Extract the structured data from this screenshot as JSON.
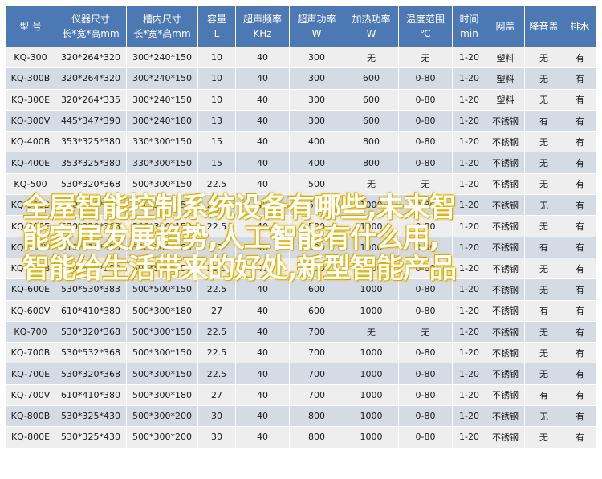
{
  "table": {
    "headers": [
      [
        "型 号",
        ""
      ],
      [
        "仪器尺寸",
        "长*宽*高mm"
      ],
      [
        "槽内尺寸",
        "长*宽*高mm"
      ],
      [
        "容量",
        "L"
      ],
      [
        "超声频率",
        "KHz"
      ],
      [
        "超声功率",
        "W"
      ],
      [
        "加热功率",
        "W"
      ],
      [
        "温度范围",
        "℃"
      ],
      [
        "时间",
        "min"
      ],
      [
        "网盖",
        ""
      ],
      [
        "降音盖",
        ""
      ],
      [
        "排水",
        ""
      ]
    ],
    "rows": [
      [
        "KQ-300",
        "320*264*320",
        "300*240*150",
        "10",
        "40",
        "300",
        "无",
        "无",
        "1-20",
        "塑料",
        "无",
        "有"
      ],
      [
        "KQ-300B",
        "320*264*320",
        "300*240*150",
        "10",
        "40",
        "300",
        "600",
        "0-80",
        "1-20",
        "塑料",
        "无",
        "有"
      ],
      [
        "KQ-300E",
        "320*264*335",
        "300*240*150",
        "10",
        "40",
        "300",
        "600",
        "0-80",
        "1-20",
        "塑料",
        "无",
        "有"
      ],
      [
        "KQ-300V",
        "445*347*390",
        "300*240*180",
        "13",
        "40",
        "300",
        "600",
        "0-80",
        "1-20",
        "不锈钢",
        "有",
        "有"
      ],
      [
        "KQ-400B",
        "353*325*380",
        "330*300*150",
        "15",
        "40",
        "400",
        "800",
        "0-80",
        "1-20",
        "不锈钢",
        "无",
        "有"
      ],
      [
        "KQ-400E",
        "353*325*380",
        "330*300*150",
        "15",
        "40",
        "400",
        "800",
        "0-80",
        "1-20",
        "不锈钢",
        "无",
        "有"
      ],
      [
        "KQ-500",
        "530*320*368",
        "500*300*150",
        "22.5",
        "40",
        "500",
        "无",
        "无",
        "1-20",
        "不锈钢",
        "无",
        "有"
      ],
      [
        "KQ-500B",
        "530*320*368",
        "500*300*150",
        "22.5",
        "40",
        "500",
        "1000",
        "0-80",
        "1-20",
        "不锈钢",
        "无",
        "有"
      ],
      [
        "KQ-500E",
        "530*320*368",
        "500*300*150",
        "22.5",
        "40",
        "500",
        "1000",
        "0-80",
        "1-20",
        "不锈钢",
        "无",
        "有"
      ],
      [
        "KQ-500V",
        "610*410*380",
        "500*300*180",
        "27",
        "40",
        "500",
        "1000",
        "0-80",
        "1-20",
        "不锈钢",
        "有",
        "有"
      ],
      [
        "KQ-600B",
        "530*530*383",
        "500*500*150",
        "22.5",
        "40",
        "600",
        "1000",
        "0-80",
        "1-20",
        "不锈钢",
        "无",
        "有"
      ],
      [
        "KQ-600E",
        "530*530*383",
        "500*500*150",
        "22.5",
        "40",
        "600",
        "1000",
        "0-80",
        "1-20",
        "不锈钢",
        "无",
        "有"
      ],
      [
        "KQ-600V",
        "610*410*380",
        "500*300*180",
        "27",
        "40",
        "600",
        "1000",
        "0-80",
        "1-20",
        "不锈钢",
        "有",
        "有"
      ],
      [
        "KQ-700",
        "530*320*368",
        "500*300*150",
        "22.5",
        "40",
        "700",
        "无",
        "无",
        "1-20",
        "不锈钢",
        "无",
        "有"
      ],
      [
        "KQ-700B",
        "530*532*368",
        "500*300*150",
        "22.5",
        "40",
        "700",
        "1000",
        "0-80",
        "1-20",
        "不锈钢",
        "无",
        "有"
      ],
      [
        "KQ-700E",
        "530*320*368",
        "500*300*150",
        "22.5",
        "40",
        "700",
        "1000",
        "0-80",
        "1-20",
        "不锈钢",
        "无",
        "有"
      ],
      [
        "KQ-700V",
        "610*410*380",
        "500*300*180",
        "27",
        "40",
        "700",
        "1000",
        "0-80",
        "1-20",
        "不锈钢",
        "有",
        "有"
      ],
      [
        "KQ-800B",
        "530*325*430",
        "500*300*200",
        "30",
        "40",
        "800",
        "1000",
        "0-80",
        "1-20",
        "不锈钢",
        "无",
        "有"
      ],
      [
        "KQ-800E",
        "530*325*430",
        "500*300*200",
        "30",
        "40",
        "800",
        "1000",
        "0-80",
        "1-20",
        "不锈钢",
        "无",
        "有"
      ]
    ]
  },
  "overlay": {
    "lines": [
      "全屋智能控制系统设备有哪些,未来智",
      "能家居发展趋势,人工智能有什么用,",
      "智能给生活带来的好处,新型智能产品"
    ]
  },
  "colors": {
    "header_bg": "#4c78b4",
    "row_light": "#eeeeef",
    "row_dark": "#d5dbe5",
    "overlay_glow": "#e8b800"
  }
}
